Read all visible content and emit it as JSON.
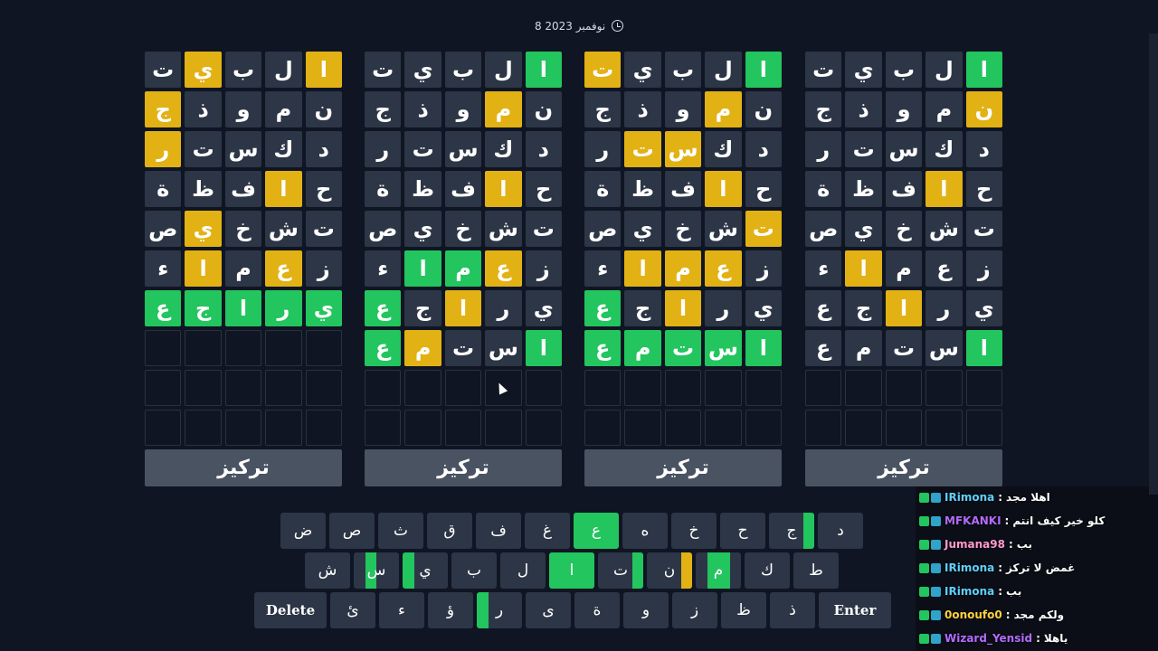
{
  "header": {
    "date": "8 نوفمبر 2023"
  },
  "boards": [
    {
      "rows": [
        [
          [
            "ا",
            "y"
          ],
          [
            "ل",
            ""
          ],
          [
            "ب",
            ""
          ],
          [
            "ي",
            "y"
          ],
          [
            "ت",
            ""
          ]
        ],
        [
          [
            "ن",
            ""
          ],
          [
            "م",
            ""
          ],
          [
            "و",
            ""
          ],
          [
            "ذ",
            ""
          ],
          [
            "ج",
            "y"
          ]
        ],
        [
          [
            "د",
            ""
          ],
          [
            "ك",
            ""
          ],
          [
            "س",
            ""
          ],
          [
            "ت",
            ""
          ],
          [
            "ر",
            "y"
          ]
        ],
        [
          [
            "ح",
            ""
          ],
          [
            "ا",
            "y"
          ],
          [
            "ف",
            ""
          ],
          [
            "ظ",
            ""
          ],
          [
            "ة",
            ""
          ]
        ],
        [
          [
            "ت",
            ""
          ],
          [
            "ش",
            ""
          ],
          [
            "خ",
            ""
          ],
          [
            "ي",
            "y"
          ],
          [
            "ص",
            ""
          ]
        ],
        [
          [
            "ز",
            ""
          ],
          [
            "ع",
            "y"
          ],
          [
            "م",
            ""
          ],
          [
            "ا",
            "y"
          ],
          [
            "ء",
            ""
          ]
        ],
        [
          [
            "ي",
            "g"
          ],
          [
            "ر",
            "g"
          ],
          [
            "ا",
            "g"
          ],
          [
            "ج",
            "g"
          ],
          [
            "ع",
            "g"
          ]
        ]
      ],
      "focus_label": "تركيز"
    },
    {
      "rows": [
        [
          [
            "ا",
            "g"
          ],
          [
            "ل",
            ""
          ],
          [
            "ب",
            ""
          ],
          [
            "ي",
            ""
          ],
          [
            "ت",
            ""
          ]
        ],
        [
          [
            "ن",
            ""
          ],
          [
            "م",
            "y"
          ],
          [
            "و",
            ""
          ],
          [
            "ذ",
            ""
          ],
          [
            "ج",
            ""
          ]
        ],
        [
          [
            "د",
            ""
          ],
          [
            "ك",
            ""
          ],
          [
            "س",
            ""
          ],
          [
            "ت",
            ""
          ],
          [
            "ر",
            ""
          ]
        ],
        [
          [
            "ح",
            ""
          ],
          [
            "ا",
            "y"
          ],
          [
            "ف",
            ""
          ],
          [
            "ظ",
            ""
          ],
          [
            "ة",
            ""
          ]
        ],
        [
          [
            "ت",
            ""
          ],
          [
            "ش",
            ""
          ],
          [
            "خ",
            ""
          ],
          [
            "ي",
            ""
          ],
          [
            "ص",
            ""
          ]
        ],
        [
          [
            "ز",
            ""
          ],
          [
            "ع",
            "y"
          ],
          [
            "م",
            "g"
          ],
          [
            "ا",
            "g"
          ],
          [
            "ء",
            ""
          ]
        ],
        [
          [
            "ي",
            ""
          ],
          [
            "ر",
            ""
          ],
          [
            "ا",
            "y"
          ],
          [
            "ج",
            ""
          ],
          [
            "ع",
            "g"
          ]
        ],
        [
          [
            "ا",
            "g"
          ],
          [
            "س",
            ""
          ],
          [
            "ت",
            ""
          ],
          [
            "م",
            "y"
          ],
          [
            "ع",
            "g"
          ]
        ]
      ],
      "focus_label": "تركيز"
    },
    {
      "rows": [
        [
          [
            "ا",
            "g"
          ],
          [
            "ل",
            ""
          ],
          [
            "ب",
            ""
          ],
          [
            "ي",
            ""
          ],
          [
            "ت",
            "y"
          ]
        ],
        [
          [
            "ن",
            ""
          ],
          [
            "م",
            "y"
          ],
          [
            "و",
            ""
          ],
          [
            "ذ",
            ""
          ],
          [
            "ج",
            ""
          ]
        ],
        [
          [
            "د",
            ""
          ],
          [
            "ك",
            ""
          ],
          [
            "س",
            "y"
          ],
          [
            "ت",
            "y"
          ],
          [
            "ر",
            ""
          ]
        ],
        [
          [
            "ح",
            ""
          ],
          [
            "ا",
            "y"
          ],
          [
            "ف",
            ""
          ],
          [
            "ظ",
            ""
          ],
          [
            "ة",
            ""
          ]
        ],
        [
          [
            "ت",
            "y"
          ],
          [
            "ش",
            ""
          ],
          [
            "خ",
            ""
          ],
          [
            "ي",
            ""
          ],
          [
            "ص",
            ""
          ]
        ],
        [
          [
            "ز",
            ""
          ],
          [
            "ع",
            "y"
          ],
          [
            "م",
            "y"
          ],
          [
            "ا",
            "y"
          ],
          [
            "ء",
            ""
          ]
        ],
        [
          [
            "ي",
            ""
          ],
          [
            "ر",
            ""
          ],
          [
            "ا",
            "y"
          ],
          [
            "ج",
            ""
          ],
          [
            "ع",
            "g"
          ]
        ],
        [
          [
            "ا",
            "g"
          ],
          [
            "س",
            "g"
          ],
          [
            "ت",
            "g"
          ],
          [
            "م",
            "g"
          ],
          [
            "ع",
            "g"
          ]
        ]
      ],
      "focus_label": "تركيز"
    },
    {
      "rows": [
        [
          [
            "ا",
            "g"
          ],
          [
            "ل",
            ""
          ],
          [
            "ب",
            ""
          ],
          [
            "ي",
            ""
          ],
          [
            "ت",
            ""
          ]
        ],
        [
          [
            "ن",
            "y"
          ],
          [
            "م",
            ""
          ],
          [
            "و",
            ""
          ],
          [
            "ذ",
            ""
          ],
          [
            "ج",
            ""
          ]
        ],
        [
          [
            "د",
            ""
          ],
          [
            "ك",
            ""
          ],
          [
            "س",
            ""
          ],
          [
            "ت",
            ""
          ],
          [
            "ر",
            ""
          ]
        ],
        [
          [
            "ح",
            ""
          ],
          [
            "ا",
            "y"
          ],
          [
            "ف",
            ""
          ],
          [
            "ظ",
            ""
          ],
          [
            "ة",
            ""
          ]
        ],
        [
          [
            "ت",
            ""
          ],
          [
            "ش",
            ""
          ],
          [
            "خ",
            ""
          ],
          [
            "ي",
            ""
          ],
          [
            "ص",
            ""
          ]
        ],
        [
          [
            "ز",
            ""
          ],
          [
            "ع",
            ""
          ],
          [
            "م",
            ""
          ],
          [
            "ا",
            "y"
          ],
          [
            "ء",
            ""
          ]
        ],
        [
          [
            "ي",
            ""
          ],
          [
            "ر",
            ""
          ],
          [
            "ا",
            "y"
          ],
          [
            "ج",
            ""
          ],
          [
            "ع",
            ""
          ]
        ],
        [
          [
            "ا",
            "g"
          ],
          [
            "س",
            ""
          ],
          [
            "ت",
            ""
          ],
          [
            "م",
            ""
          ],
          [
            "ع",
            ""
          ]
        ]
      ],
      "focus_label": "تركيز"
    }
  ],
  "keyboard": {
    "row1": [
      {
        "k": "د",
        "q": []
      },
      {
        "k": "ج",
        "q": [
          "g",
          "",
          "",
          ""
        ]
      },
      {
        "k": "ح",
        "q": []
      },
      {
        "k": "خ",
        "q": []
      },
      {
        "k": "ه",
        "q": []
      },
      {
        "k": "ع",
        "q": [
          "g",
          "g",
          "g",
          "g"
        ]
      },
      {
        "k": "غ",
        "q": []
      },
      {
        "k": "ف",
        "q": []
      },
      {
        "k": "ق",
        "q": []
      },
      {
        "k": "ث",
        "q": []
      },
      {
        "k": "ص",
        "q": []
      },
      {
        "k": "ض",
        "q": []
      }
    ],
    "row2": [
      {
        "k": "ط",
        "q": []
      },
      {
        "k": "ك",
        "q": []
      },
      {
        "k": "م",
        "q": [
          "",
          "g",
          "g",
          ""
        ]
      },
      {
        "k": "ن",
        "q": [
          "y",
          "",
          "",
          ""
        ]
      },
      {
        "k": "ت",
        "q": [
          "g",
          "",
          "",
          ""
        ]
      },
      {
        "k": "ا",
        "q": [
          "g",
          "g",
          "g",
          "g"
        ]
      },
      {
        "k": "ل",
        "q": []
      },
      {
        "k": "ب",
        "q": []
      },
      {
        "k": "ي",
        "q": [
          "",
          "",
          "",
          "g"
        ]
      },
      {
        "k": "س",
        "q": [
          "",
          "",
          "g",
          ""
        ]
      },
      {
        "k": "ش",
        "q": []
      }
    ],
    "row3": [
      {
        "k": "Enter",
        "q": [],
        "wide": true
      },
      {
        "k": "ذ",
        "q": []
      },
      {
        "k": "ظ",
        "q": []
      },
      {
        "k": "ز",
        "q": []
      },
      {
        "k": "و",
        "q": []
      },
      {
        "k": "ة",
        "q": []
      },
      {
        "k": "ى",
        "q": []
      },
      {
        "k": "ر",
        "q": [
          "",
          "",
          "",
          "g"
        ]
      },
      {
        "k": "ؤ",
        "q": []
      },
      {
        "k": "ء",
        "q": []
      },
      {
        "k": "ئ",
        "q": []
      },
      {
        "k": "Delete",
        "q": [],
        "wide": true
      }
    ]
  },
  "chat": [
    {
      "user": "IRimona",
      "msg": "اهلا مجد",
      "color": "#5fd0ff"
    },
    {
      "user": "MFKANKI",
      "msg": "كلو خير كيف انتم",
      "color": "#b36bff"
    },
    {
      "user": "Jumana98",
      "msg": "بب",
      "color": "#ff9ad2"
    },
    {
      "user": "IRimona",
      "msg": "غمض لا تركز",
      "color": "#5fd0ff"
    },
    {
      "user": "IRimona",
      "msg": "بب",
      "color": "#5fd0ff"
    },
    {
      "user": "0onoufo0",
      "msg": "ولكم مجد",
      "color": "#ffd23f"
    },
    {
      "user": "Wizard_Yensid",
      "msg": "ياهلا",
      "color": "#b36bff"
    }
  ],
  "colors": {
    "correct": "#22c55e",
    "present": "#e2b114",
    "tile": "#2d3646",
    "background": "#0f1523"
  }
}
